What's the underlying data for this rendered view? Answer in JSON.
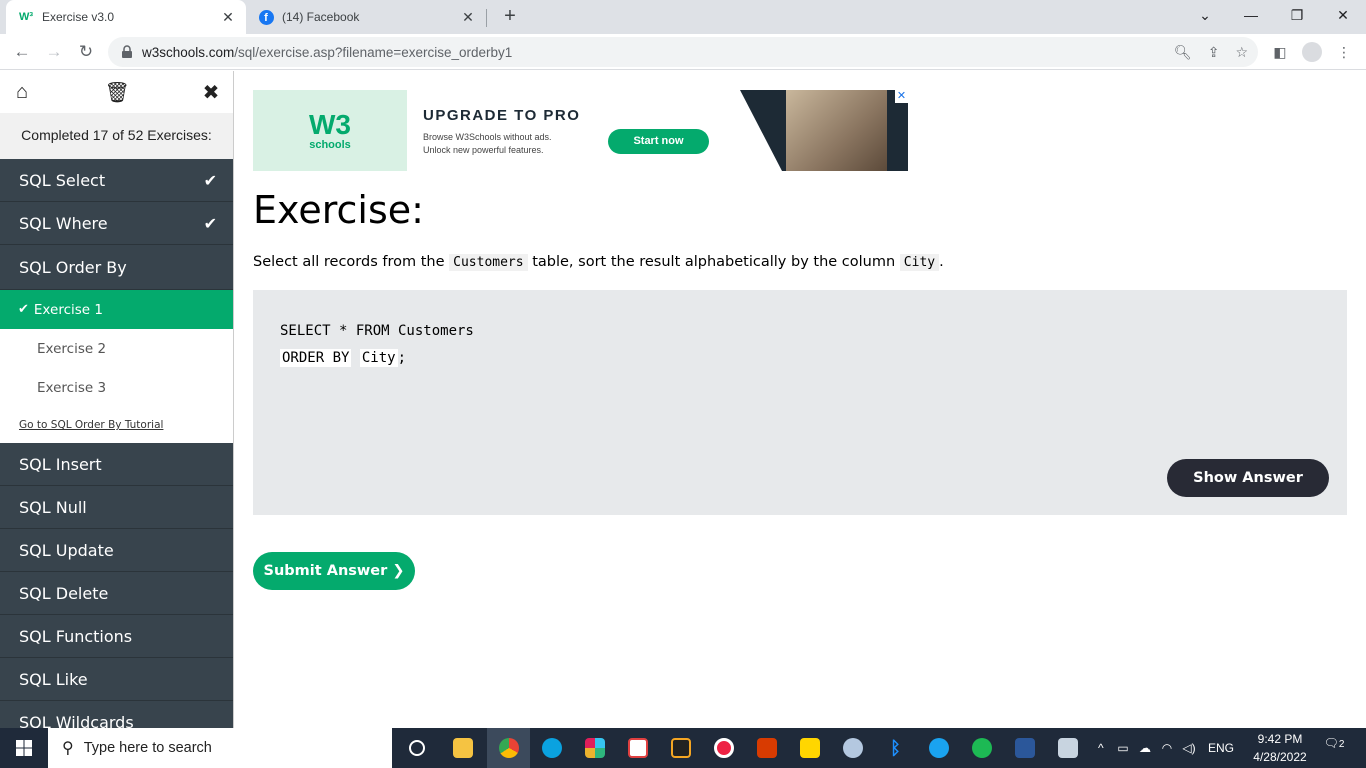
{
  "browser": {
    "tabs": [
      {
        "title": "Exercise v3.0",
        "favicon": "w3schools-icon"
      },
      {
        "title": "(14) Facebook",
        "favicon": "facebook-icon"
      }
    ],
    "url_host": "w3schools.com",
    "url_path": "/sql/exercise.asp?filename=exercise_orderby1"
  },
  "sidebar": {
    "progress": "Completed 17 of 52 Exercises:",
    "categories": [
      {
        "label": "SQL Select",
        "completed": true
      },
      {
        "label": "SQL Where",
        "completed": true
      },
      {
        "label": "SQL Order By",
        "completed": false
      }
    ],
    "subitems": [
      "Exercise 1",
      "Exercise 2",
      "Exercise 3"
    ],
    "tutorial_link": "Go to SQL Order By Tutorial",
    "more_categories": [
      "SQL Insert",
      "SQL Null",
      "SQL Update",
      "SQL Delete",
      "SQL Functions",
      "SQL Like",
      "SQL Wildcards"
    ]
  },
  "ad": {
    "logo_text": "W3",
    "logo_sub": "schools",
    "heading": "UPGRADE TO PRO",
    "line1": "Browse W3Schools without ads.",
    "line2": "Unlock new powerful features.",
    "button": "Start now"
  },
  "exercise": {
    "title": "Exercise:",
    "desc_pre": "Select all records from the",
    "desc_table": "Customers",
    "desc_mid": "table, sort the result alphabetically by the column",
    "desc_col": "City",
    "desc_end": ".",
    "code_line1": "SELECT * FROM Customers",
    "code_input1": "ORDER BY",
    "code_input2": "City",
    "code_end": ";",
    "show_answer": "Show Answer",
    "submit": "Submit Answer ❯"
  },
  "taskbar": {
    "search_placeholder": "Type here to search",
    "lang": "ENG",
    "time": "9:42 PM",
    "date": "4/28/2022",
    "notifications": "2"
  },
  "colors": {
    "accent": "#04aa6d",
    "sidebar_dark": "#38444d",
    "button_dark": "#282a35"
  }
}
